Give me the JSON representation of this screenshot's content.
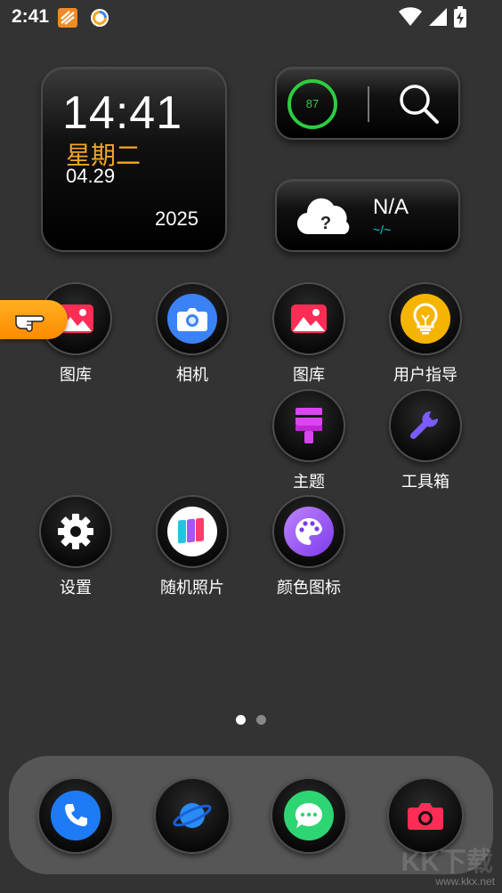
{
  "status_bar": {
    "time": "2:41",
    "icons": [
      "app-notification-icon",
      "sync-circle-icon",
      "wifi-icon",
      "signal-icon",
      "battery-charging-icon"
    ]
  },
  "clock_widget": {
    "time": "14:41",
    "weekday": "星期二",
    "date": "04.29",
    "year": "2025",
    "accent_color": "#f5a623"
  },
  "battery_widget": {
    "battery_level": "87",
    "battery_fraction": 0.87,
    "ring_color": "#2ecc40",
    "search_icon": "search-icon"
  },
  "weather_widget": {
    "temperature": "N/A",
    "range": "~/~",
    "icon": "cloud-question-icon"
  },
  "apps": [
    {
      "label": "图库",
      "icon": "gallery-icon"
    },
    {
      "label": "相机",
      "icon": "camera-icon"
    },
    {
      "label": "图库",
      "icon": "gallery-icon"
    },
    {
      "label": "用户指导",
      "icon": "lightbulb-icon"
    },
    {
      "label": "主题",
      "icon": "paintbrush-icon"
    },
    {
      "label": "工具箱",
      "icon": "wrench-icon"
    },
    {
      "label": "设置",
      "icon": "gear-icon"
    },
    {
      "label": "随机照片",
      "icon": "random-photo-icon"
    },
    {
      "label": "颜色图标",
      "icon": "palette-icon"
    }
  ],
  "page_indicator": {
    "pages": 2,
    "active": 0
  },
  "dock": {
    "items": [
      {
        "icon": "phone-icon"
      },
      {
        "icon": "browser-planet-icon"
      },
      {
        "icon": "message-icon"
      },
      {
        "icon": "camera-icon"
      }
    ]
  },
  "watermark": {
    "logo_text": "KK下载",
    "url": "www.kkx.net"
  }
}
